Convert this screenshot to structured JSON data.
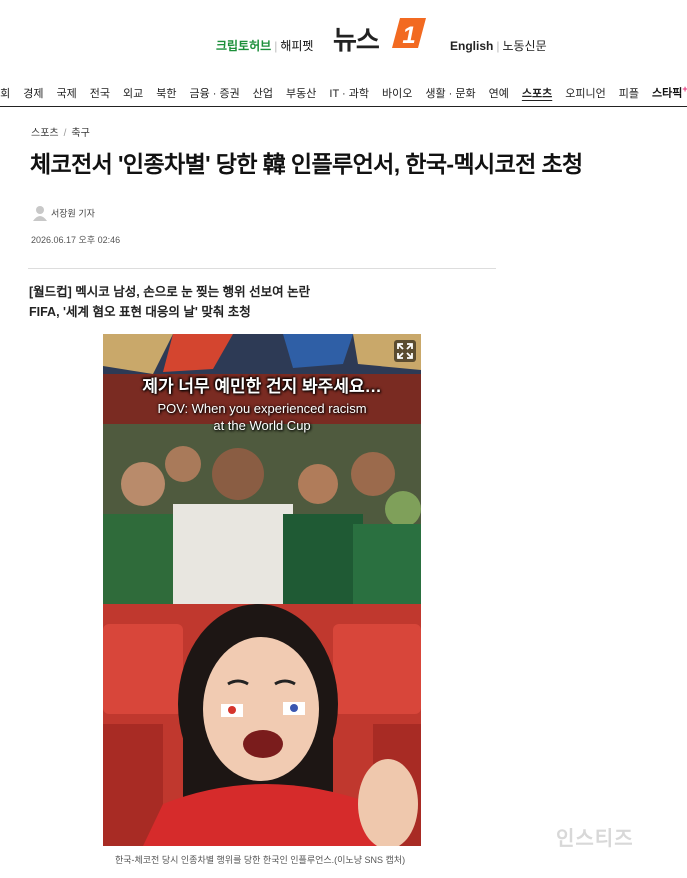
{
  "header": {
    "left_link": "크립토허브",
    "left_link2": "해피펫",
    "logo_text": "뉴스",
    "logo_badge": "1",
    "english": "English",
    "labor_paper": "노동신문"
  },
  "nav": {
    "items": [
      "사회",
      "경제",
      "국제",
      "전국",
      "외교",
      "북한",
      "금융 · 증권",
      "산업",
      "부동산",
      "IT · 과학",
      "바이오",
      "생활 · 문화",
      "연예",
      "스포츠",
      "오피니언",
      "피플"
    ],
    "active": "스포츠",
    "star_label": "스타",
    "star_label_suffix": "픽",
    "star_mark": "+"
  },
  "article": {
    "breadcrumb": [
      "스포츠",
      "축구"
    ],
    "headline": "체코전서 '인종차별' 당한 韓 인플루언서, 한국-멕시코전 초청",
    "reporter": "서장원 기자",
    "date": "2026.06.17 오후 02:46",
    "summary": [
      "[월드컵] 멕시코 남성, 손으로 눈 찢는 행위 선보여 논란",
      "FIFA, '세계 혐오 표현 대응의 날' 맞춰 초청"
    ]
  },
  "photo": {
    "overlay_ko": "제가 너무 예민한 건지 봐주세요…",
    "overlay_en_line1": "POV: When you experienced racism",
    "overlay_en_line2": "at the World Cup",
    "caption": "한국-체코전 당시 인종차별 행위를 당한 한국인 인플루언스.(이노냥 SNS 캡처)",
    "expand_icon": "expand-icon"
  },
  "watermark": "인스티즈",
  "colors": {
    "green": "#1c8f3a",
    "logo_orange": "#f26a21",
    "pink": "#e9337a"
  }
}
